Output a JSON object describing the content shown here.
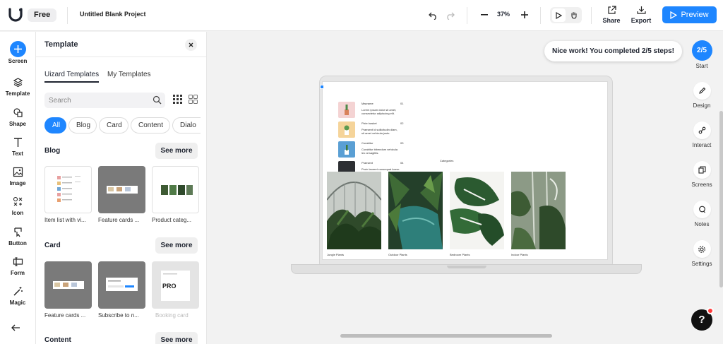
{
  "app": {
    "plan": "Free",
    "project_title": "Untitled Blank Project",
    "zoom": "37%"
  },
  "top_actions": {
    "share": "Share",
    "export": "Export",
    "preview": "Preview"
  },
  "left_rail": [
    {
      "label": "Screen",
      "icon": "plus-icon"
    },
    {
      "label": "Template",
      "icon": "layers-icon"
    },
    {
      "label": "Shape",
      "icon": "shape-icon"
    },
    {
      "label": "Text",
      "icon": "text-icon"
    },
    {
      "label": "Image",
      "icon": "image-icon"
    },
    {
      "label": "Icon",
      "icon": "icon-set-icon"
    },
    {
      "label": "Button",
      "icon": "button-icon"
    },
    {
      "label": "Form",
      "icon": "form-icon"
    },
    {
      "label": "Magic",
      "icon": "magic-wand-icon"
    }
  ],
  "panel": {
    "title": "Template",
    "tabs": [
      "Uizard Templates",
      "My Templates"
    ],
    "search_placeholder": "Search",
    "chips": [
      "All",
      "Blog",
      "Card",
      "Content",
      "Dialo"
    ],
    "sections": [
      {
        "title": "Blog",
        "see_more": "See more",
        "items": [
          "Item list with vi...",
          "Feature cards ...",
          "Product categ..."
        ]
      },
      {
        "title": "Card",
        "see_more": "See more",
        "items": [
          "Feature cards ...",
          "Subscribe to n...",
          "Booking card"
        ],
        "pro_label": "PRO"
      },
      {
        "title": "Content",
        "see_more": "See more"
      }
    ]
  },
  "canvas": {
    "list_items": [
      {
        "title": "Macrame",
        "num": "01",
        "desc1": "Lorem ipsum dolor sit amet,",
        "desc2": "consectetur adipiscing elit."
      },
      {
        "title": "Pixie basket",
        "num": "02",
        "desc1": "Praesent id sollicitudin diam,",
        "desc2": "sit amet vehicula justo."
      },
      {
        "title": "Curabitur",
        "num": "03",
        "desc1": "Curabitur bibendum vehicula",
        "desc2": "leo at sagittis."
      },
      {
        "title": "Praesent",
        "num": "04",
        "desc1": "Proin laoreet consequat lorem.",
        "desc2": ""
      }
    ],
    "categories_label": "Categories",
    "photos": [
      "Jungle Plants",
      "Outdoor Plants",
      "Bedroom Plants",
      "Indoor Plants"
    ]
  },
  "toast": "Nice work! You completed 2/5 steps!",
  "right_rail": {
    "progress": "2/5",
    "start": "Start",
    "items": [
      {
        "label": "Design",
        "icon": "pencil-icon"
      },
      {
        "label": "Interact",
        "icon": "link-icon"
      },
      {
        "label": "Screens",
        "icon": "screens-icon"
      },
      {
        "label": "Notes",
        "icon": "chat-bubble-icon"
      },
      {
        "label": "Settings",
        "icon": "gear-icon"
      }
    ]
  },
  "help": "?",
  "colors": {
    "accent": "#1e86ff"
  }
}
